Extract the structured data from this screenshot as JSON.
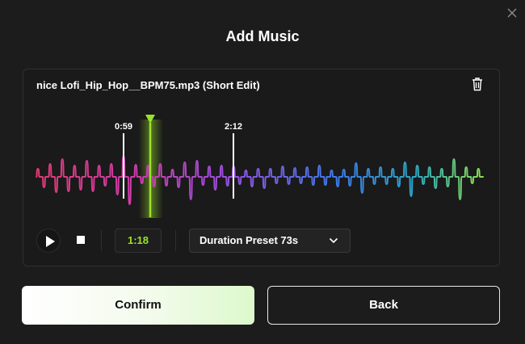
{
  "dialog": {
    "title": "Add Music"
  },
  "track": {
    "filename": "nice Lofi_Hip_Hop__BPM75.mp3 (Short Edit)",
    "markers": [
      {
        "label": "0:59"
      },
      {
        "label": "2:12"
      }
    ]
  },
  "controls": {
    "current_time": "1:18",
    "duration_preset": "Duration Preset 73s"
  },
  "buttons": {
    "confirm": "Confirm",
    "back": "Back"
  },
  "colors": {
    "playhead": "#9be22a",
    "wave_start": "#e23a74",
    "wave_mid_purple": "#9b4fe0",
    "wave_mid_blue": "#3a7be8",
    "wave_end": "#8be04a"
  },
  "icons": {
    "close": "close-icon",
    "trash": "trash-icon",
    "play": "play-icon",
    "stop": "stop-icon",
    "chevron": "chevron-down-icon"
  }
}
